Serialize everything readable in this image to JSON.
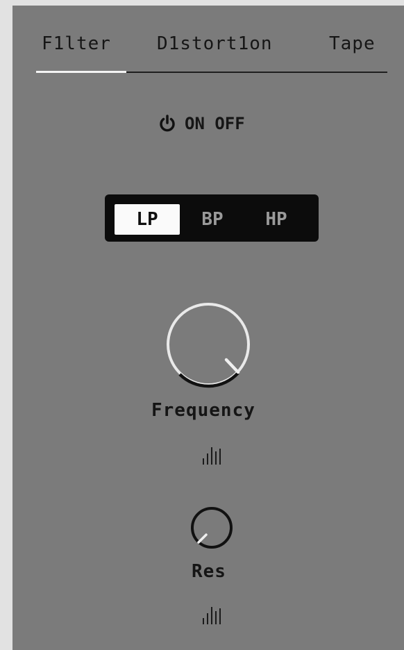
{
  "tabs": [
    {
      "label": "F1lter",
      "active": true
    },
    {
      "label": "D1stort1on",
      "active": false
    },
    {
      "label": "Tape",
      "active": false
    }
  ],
  "power": {
    "label": "ON OFF",
    "icon": "power-icon"
  },
  "filter_type": {
    "options": [
      "LP",
      "BP",
      "HP"
    ],
    "selected": "LP"
  },
  "knobs": {
    "frequency": {
      "label": "Frequency",
      "icon": "modulation-bars-icon"
    },
    "res": {
      "label": "Res",
      "icon": "modulation-bars-icon"
    }
  },
  "colors": {
    "panel": "#7b7b7b",
    "accent": "#f4f4f4",
    "dark": "#0c0c0c"
  }
}
